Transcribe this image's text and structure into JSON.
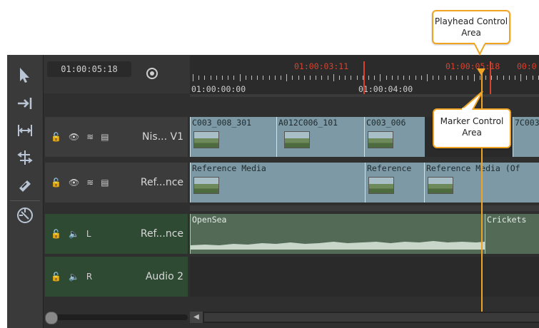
{
  "timecode": "01:00:05:18",
  "ruler": {
    "label_0": "01:00:00:00",
    "label_4": "01:00:04:00",
    "marker_in": "01:00:03:11",
    "playhead_time": "01:00:05:18",
    "marker_out_partial": "00:0"
  },
  "tracks": {
    "v1": {
      "name": "Nis... V1"
    },
    "v2": {
      "name": "Ref...nce"
    },
    "a1": {
      "name": "Ref...nce",
      "channel": "L"
    },
    "a2": {
      "name": "Audio 2",
      "channel": "R"
    }
  },
  "clips_v1": [
    {
      "label": "C003_008_301"
    },
    {
      "label": "A012C006_101"
    },
    {
      "label": "C003_006"
    },
    {
      "label": "7C003"
    }
  ],
  "clips_v2": [
    {
      "label": "Reference Media"
    },
    {
      "label": "Reference"
    },
    {
      "label": "Reference Media (Of"
    }
  ],
  "clips_audio": [
    {
      "label": "OpenSea"
    },
    {
      "label": "Crickets"
    }
  ],
  "callouts": {
    "playhead": "Playhead Control Area",
    "marker": "Marker Control Area"
  },
  "colors": {
    "callout_border": "#f1a422",
    "playhead": "#f1a422",
    "marker": "#d9412c"
  }
}
